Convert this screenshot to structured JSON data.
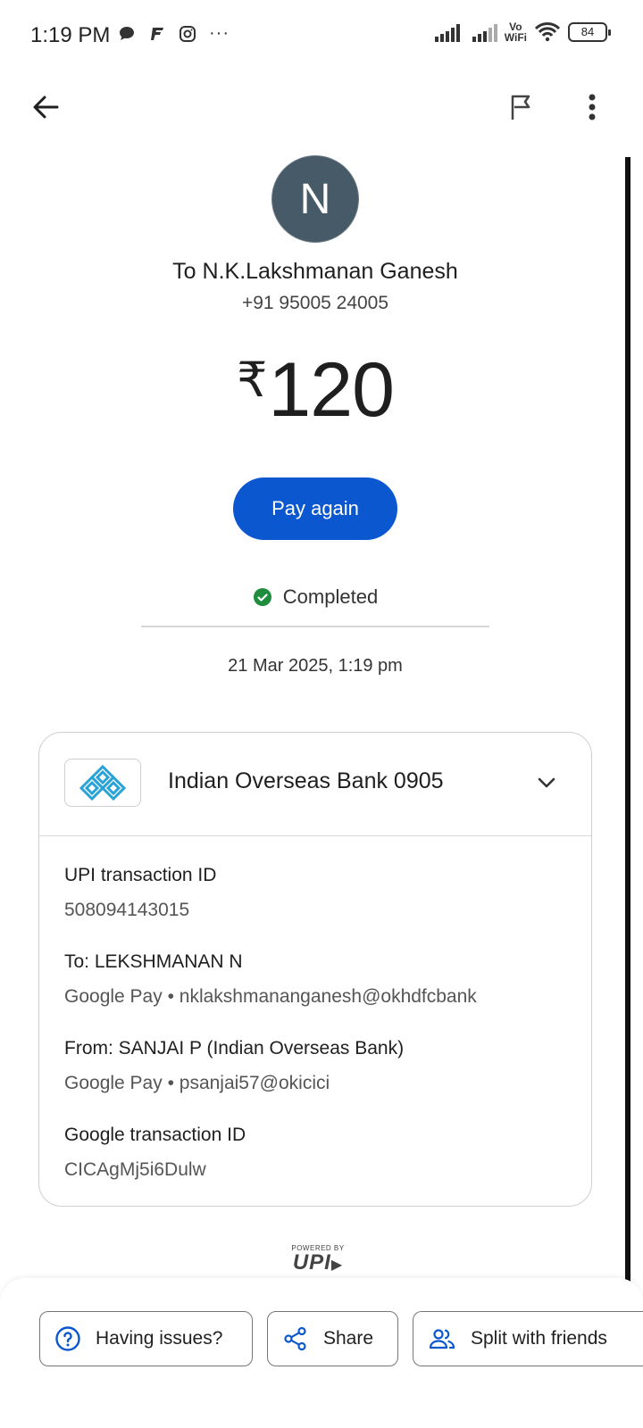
{
  "status_bar": {
    "time": "1:19 PM",
    "left_icons": [
      "chat-bubble-icon",
      "f-app-icon",
      "instagram-icon",
      "more-dots-icon"
    ],
    "more": "···",
    "vowifi": "Vo",
    "wifi_label": "WiFi",
    "battery": "84"
  },
  "toolbar": {
    "icons": [
      "back-arrow-icon",
      "flag-icon",
      "more-vert-icon"
    ]
  },
  "payee": {
    "avatar_letter": "N",
    "avatar_color": "#475a67",
    "to_line": "To N.K.Lakshmanan Ganesh",
    "phone": "+91 95005 24005"
  },
  "amount": {
    "currency": "₹",
    "value": "120"
  },
  "pay_again_label": "Pay again",
  "accent_color": "#0b57d0",
  "status": {
    "text": "Completed",
    "color": "#1e8e3e"
  },
  "date_time": "21 Mar 2025, 1:19 pm",
  "card": {
    "bank_name": "Indian Overseas Bank 0905",
    "bank_logo": "iob-logo",
    "details": [
      {
        "label": "UPI transaction ID",
        "value": "508094143015"
      },
      {
        "label": "To: LEKSHMANAN N",
        "value": "Google Pay • nklakshmananganesh@okhdfcbank"
      },
      {
        "label": "From: SANJAI P (Indian Overseas Bank)",
        "value": "Google Pay • psanjai57@okicici"
      },
      {
        "label": "Google transaction ID",
        "value": "CICAgMj5i6Dulw"
      }
    ]
  },
  "upi_logo": {
    "powered": "POWERED BY",
    "brand": "UPI"
  },
  "actions": [
    {
      "label": "Having issues?",
      "icon": "help-circle-icon"
    },
    {
      "label": "Share",
      "icon": "share-icon"
    },
    {
      "label": "Split with friends",
      "icon": "people-icon"
    }
  ]
}
